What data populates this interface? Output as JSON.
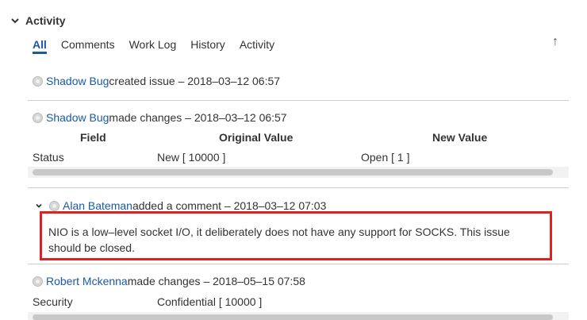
{
  "header": {
    "title": "Activity",
    "toggle_icon": "chevron-down-icon"
  },
  "tabs": [
    {
      "label": "All",
      "active": true
    },
    {
      "label": "Comments",
      "active": false
    },
    {
      "label": "Work Log",
      "active": false
    },
    {
      "label": "History",
      "active": false
    },
    {
      "label": "Activity",
      "active": false
    }
  ],
  "scroll_top_icon": "↑",
  "entries": {
    "e1": {
      "user": "Shadow Bug",
      "action": " created issue – 2018–03–12 06:57"
    },
    "e2": {
      "user": "Shadow Bug",
      "action": " made changes – 2018–03–12 06:57",
      "columns": [
        "Field",
        "Original Value",
        "New Value"
      ],
      "row": {
        "field": "Status",
        "original": "New [ 10000 ]",
        "new": "Open [ 1 ]"
      }
    },
    "e3": {
      "user": "Alan Bateman",
      "action": " added a comment – 2018–03–12 07:03",
      "comment": "NIO is a low–level socket I/O, it deliberately does not have any support for SOCKS. This issue should be closed."
    },
    "e4": {
      "user": "Robert Mckenna",
      "action": " made changes – 2018–05–15 07:58",
      "row": {
        "field": "Security",
        "original": "Confidential [ 10000 ]"
      }
    }
  },
  "colors": {
    "link": "#1a5aa5",
    "highlight_border": "#dd2222"
  }
}
